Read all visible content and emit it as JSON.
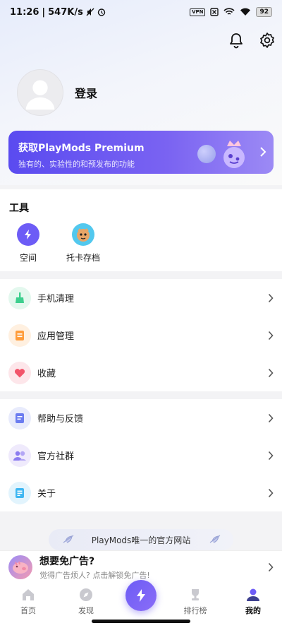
{
  "status_bar": {
    "time": "11:26",
    "speed": "547K/s",
    "vpn_label": "VPN",
    "battery": "92"
  },
  "header": {
    "icons": [
      "bell-icon",
      "settings-icon"
    ]
  },
  "profile": {
    "login_label": "登录"
  },
  "premium": {
    "title": "获取PlayMods Premium",
    "subtitle": "独有的、实验性的和预发布的功能"
  },
  "tools": {
    "title": "工具",
    "items": [
      {
        "label": "空间",
        "icon": "space-icon"
      },
      {
        "label": "托卡存档",
        "icon": "toca-save-icon"
      }
    ]
  },
  "menu_group_1": [
    {
      "label": "手机清理",
      "icon": "broom-icon",
      "color": "#3ccf8e"
    },
    {
      "label": "应用管理",
      "icon": "app-manage-icon",
      "color": "#ff9c3a"
    },
    {
      "label": "收藏",
      "icon": "heart-icon",
      "color": "#f2546a"
    }
  ],
  "menu_group_2": [
    {
      "label": "帮助与反馈",
      "icon": "help-doc-icon",
      "color": "#6b7cf0"
    },
    {
      "label": "官方社群",
      "icon": "community-icon",
      "color": "#8c7cf0"
    },
    {
      "label": "关于",
      "icon": "about-icon",
      "color": "#3fb7f2"
    }
  ],
  "site_banner": {
    "text": "PlayMods唯一的官方网站"
  },
  "ad_bar": {
    "title": "想要免广告?",
    "subtitle": "觉得广告烦人? 点击解锁免广告!"
  },
  "tab_bar": {
    "tabs": [
      {
        "label": "首页",
        "icon": "home-icon"
      },
      {
        "label": "发现",
        "icon": "compass-icon"
      },
      {
        "label": "",
        "icon": "playmods-fab-icon"
      },
      {
        "label": "排行榜",
        "icon": "trophy-icon"
      },
      {
        "label": "我的",
        "icon": "profile-icon"
      }
    ],
    "active": "我的"
  },
  "colors": {
    "accent": "#6d5cf6",
    "premium_start": "#5a4bf0",
    "premium_end": "#9c8af5"
  }
}
